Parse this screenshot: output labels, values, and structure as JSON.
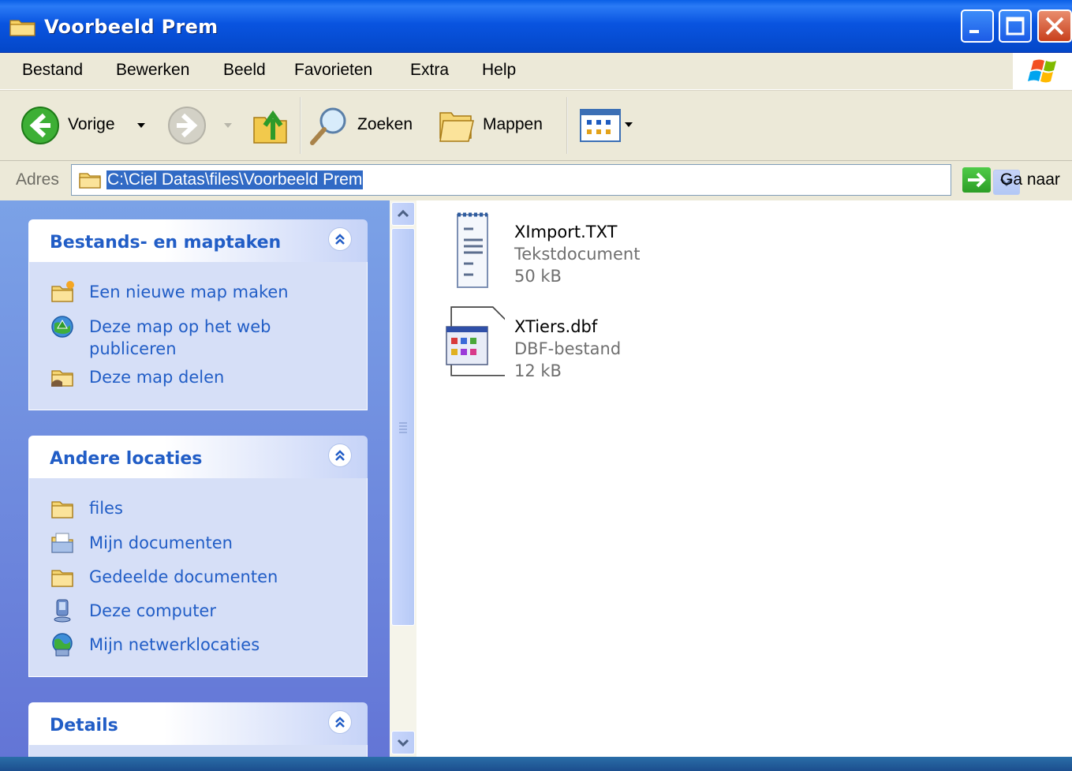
{
  "window": {
    "title": "Voorbeeld Prem"
  },
  "menu": {
    "items": [
      "Bestand",
      "Bewerken",
      "Beeld",
      "Favorieten",
      "Extra",
      "Help"
    ]
  },
  "toolbar": {
    "back_label": "Vorige",
    "search_label": "Zoeken",
    "folders_label": "Mappen"
  },
  "address": {
    "label": "Adres",
    "value": "C:\\Ciel Datas\\files\\Voorbeeld Prem",
    "go_label": "Ga naar"
  },
  "panels": {
    "tasks": {
      "title": "Bestands- en maptaken",
      "items": [
        {
          "label": "Een nieuwe map maken",
          "icon": "new-folder-icon"
        },
        {
          "label": "Deze map op het web",
          "label2": "publiceren",
          "icon": "publish-web-icon"
        },
        {
          "label": "Deze map delen",
          "icon": "share-folder-icon"
        }
      ]
    },
    "other": {
      "title": "Andere locaties",
      "items": [
        {
          "label": "files",
          "icon": "folder-icon"
        },
        {
          "label": "Mijn documenten",
          "icon": "my-documents-icon"
        },
        {
          "label": "Gedeelde documenten",
          "icon": "folder-icon"
        },
        {
          "label": "Deze computer",
          "icon": "computer-icon"
        },
        {
          "label": "Mijn netwerklocaties",
          "icon": "network-icon"
        }
      ]
    },
    "details": {
      "title": "Details"
    }
  },
  "files": [
    {
      "name": "XImport.TXT",
      "type": "Tekstdocument",
      "size": "50 kB",
      "icon": "text-document-icon"
    },
    {
      "name": "XTiers.dbf",
      "type": "DBF-bestand",
      "size": "12 kB",
      "icon": "dbf-file-icon"
    }
  ],
  "colors": {
    "titlebar": "#0A5FE6",
    "panel_title": "#215DC6",
    "selection": "#316AC5",
    "close_button": "#C8401C"
  }
}
